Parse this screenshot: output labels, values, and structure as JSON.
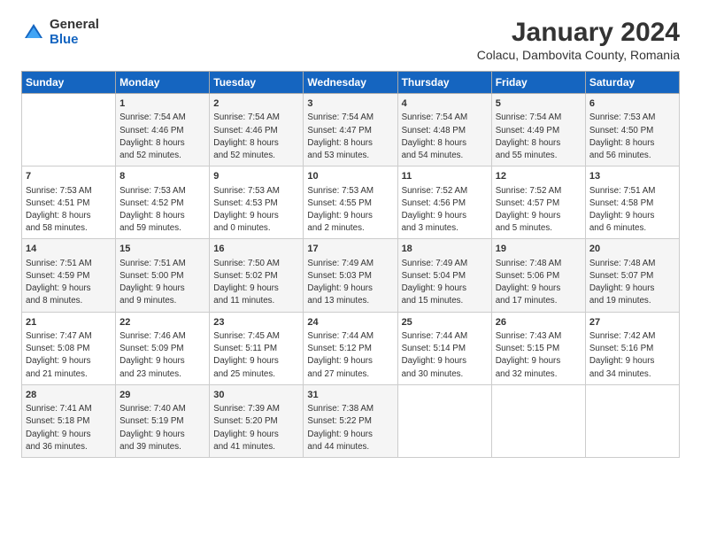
{
  "logo": {
    "general": "General",
    "blue": "Blue"
  },
  "header": {
    "title": "January 2024",
    "subtitle": "Colacu, Dambovita County, Romania"
  },
  "days_of_week": [
    "Sunday",
    "Monday",
    "Tuesday",
    "Wednesday",
    "Thursday",
    "Friday",
    "Saturday"
  ],
  "weeks": [
    [
      {
        "day": "",
        "info": ""
      },
      {
        "day": "1",
        "info": "Sunrise: 7:54 AM\nSunset: 4:46 PM\nDaylight: 8 hours\nand 52 minutes."
      },
      {
        "day": "2",
        "info": "Sunrise: 7:54 AM\nSunset: 4:46 PM\nDaylight: 8 hours\nand 52 minutes."
      },
      {
        "day": "3",
        "info": "Sunrise: 7:54 AM\nSunset: 4:47 PM\nDaylight: 8 hours\nand 53 minutes."
      },
      {
        "day": "4",
        "info": "Sunrise: 7:54 AM\nSunset: 4:48 PM\nDaylight: 8 hours\nand 54 minutes."
      },
      {
        "day": "5",
        "info": "Sunrise: 7:54 AM\nSunset: 4:49 PM\nDaylight: 8 hours\nand 55 minutes."
      },
      {
        "day": "6",
        "info": "Sunrise: 7:53 AM\nSunset: 4:50 PM\nDaylight: 8 hours\nand 56 minutes."
      }
    ],
    [
      {
        "day": "7",
        "info": "Sunrise: 7:53 AM\nSunset: 4:51 PM\nDaylight: 8 hours\nand 58 minutes."
      },
      {
        "day": "8",
        "info": "Sunrise: 7:53 AM\nSunset: 4:52 PM\nDaylight: 8 hours\nand 59 minutes."
      },
      {
        "day": "9",
        "info": "Sunrise: 7:53 AM\nSunset: 4:53 PM\nDaylight: 9 hours\nand 0 minutes."
      },
      {
        "day": "10",
        "info": "Sunrise: 7:53 AM\nSunset: 4:55 PM\nDaylight: 9 hours\nand 2 minutes."
      },
      {
        "day": "11",
        "info": "Sunrise: 7:52 AM\nSunset: 4:56 PM\nDaylight: 9 hours\nand 3 minutes."
      },
      {
        "day": "12",
        "info": "Sunrise: 7:52 AM\nSunset: 4:57 PM\nDaylight: 9 hours\nand 5 minutes."
      },
      {
        "day": "13",
        "info": "Sunrise: 7:51 AM\nSunset: 4:58 PM\nDaylight: 9 hours\nand 6 minutes."
      }
    ],
    [
      {
        "day": "14",
        "info": "Sunrise: 7:51 AM\nSunset: 4:59 PM\nDaylight: 9 hours\nand 8 minutes."
      },
      {
        "day": "15",
        "info": "Sunrise: 7:51 AM\nSunset: 5:00 PM\nDaylight: 9 hours\nand 9 minutes."
      },
      {
        "day": "16",
        "info": "Sunrise: 7:50 AM\nSunset: 5:02 PM\nDaylight: 9 hours\nand 11 minutes."
      },
      {
        "day": "17",
        "info": "Sunrise: 7:49 AM\nSunset: 5:03 PM\nDaylight: 9 hours\nand 13 minutes."
      },
      {
        "day": "18",
        "info": "Sunrise: 7:49 AM\nSunset: 5:04 PM\nDaylight: 9 hours\nand 15 minutes."
      },
      {
        "day": "19",
        "info": "Sunrise: 7:48 AM\nSunset: 5:06 PM\nDaylight: 9 hours\nand 17 minutes."
      },
      {
        "day": "20",
        "info": "Sunrise: 7:48 AM\nSunset: 5:07 PM\nDaylight: 9 hours\nand 19 minutes."
      }
    ],
    [
      {
        "day": "21",
        "info": "Sunrise: 7:47 AM\nSunset: 5:08 PM\nDaylight: 9 hours\nand 21 minutes."
      },
      {
        "day": "22",
        "info": "Sunrise: 7:46 AM\nSunset: 5:09 PM\nDaylight: 9 hours\nand 23 minutes."
      },
      {
        "day": "23",
        "info": "Sunrise: 7:45 AM\nSunset: 5:11 PM\nDaylight: 9 hours\nand 25 minutes."
      },
      {
        "day": "24",
        "info": "Sunrise: 7:44 AM\nSunset: 5:12 PM\nDaylight: 9 hours\nand 27 minutes."
      },
      {
        "day": "25",
        "info": "Sunrise: 7:44 AM\nSunset: 5:14 PM\nDaylight: 9 hours\nand 30 minutes."
      },
      {
        "day": "26",
        "info": "Sunrise: 7:43 AM\nSunset: 5:15 PM\nDaylight: 9 hours\nand 32 minutes."
      },
      {
        "day": "27",
        "info": "Sunrise: 7:42 AM\nSunset: 5:16 PM\nDaylight: 9 hours\nand 34 minutes."
      }
    ],
    [
      {
        "day": "28",
        "info": "Sunrise: 7:41 AM\nSunset: 5:18 PM\nDaylight: 9 hours\nand 36 minutes."
      },
      {
        "day": "29",
        "info": "Sunrise: 7:40 AM\nSunset: 5:19 PM\nDaylight: 9 hours\nand 39 minutes."
      },
      {
        "day": "30",
        "info": "Sunrise: 7:39 AM\nSunset: 5:20 PM\nDaylight: 9 hours\nand 41 minutes."
      },
      {
        "day": "31",
        "info": "Sunrise: 7:38 AM\nSunset: 5:22 PM\nDaylight: 9 hours\nand 44 minutes."
      },
      {
        "day": "",
        "info": ""
      },
      {
        "day": "",
        "info": ""
      },
      {
        "day": "",
        "info": ""
      }
    ]
  ]
}
